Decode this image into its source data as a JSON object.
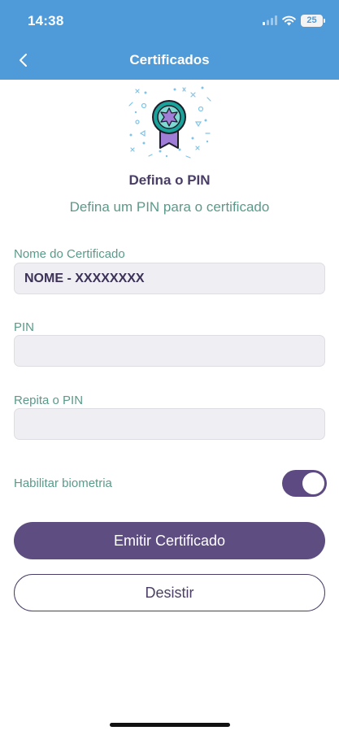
{
  "status_bar": {
    "time": "14:38",
    "battery": "25"
  },
  "header": {
    "title": "Certificados"
  },
  "main": {
    "heading": "Defina o PIN",
    "subheading": "Defina um PIN para o certificado"
  },
  "form": {
    "name": {
      "label": "Nome do Certificado",
      "value": "NOME - XXXXXXXX"
    },
    "pin": {
      "label": "PIN",
      "value": ""
    },
    "pin_repeat": {
      "label": "Repita o PIN",
      "value": ""
    },
    "biometry": {
      "label": "Habilitar biometria",
      "enabled": true
    }
  },
  "buttons": {
    "primary": "Emitir Certificado",
    "secondary": "Desistir"
  },
  "colors": {
    "header": "#4f9bd9",
    "primary": "#5e4d81",
    "label": "#5a9a8a",
    "heading": "#4a3e66",
    "badge_teal": "#1aa39a",
    "badge_purple": "#a07ed8"
  },
  "icons": [
    "back-chevron-icon",
    "signal-icon",
    "wifi-icon",
    "battery-icon",
    "certificate-badge-icon"
  ]
}
